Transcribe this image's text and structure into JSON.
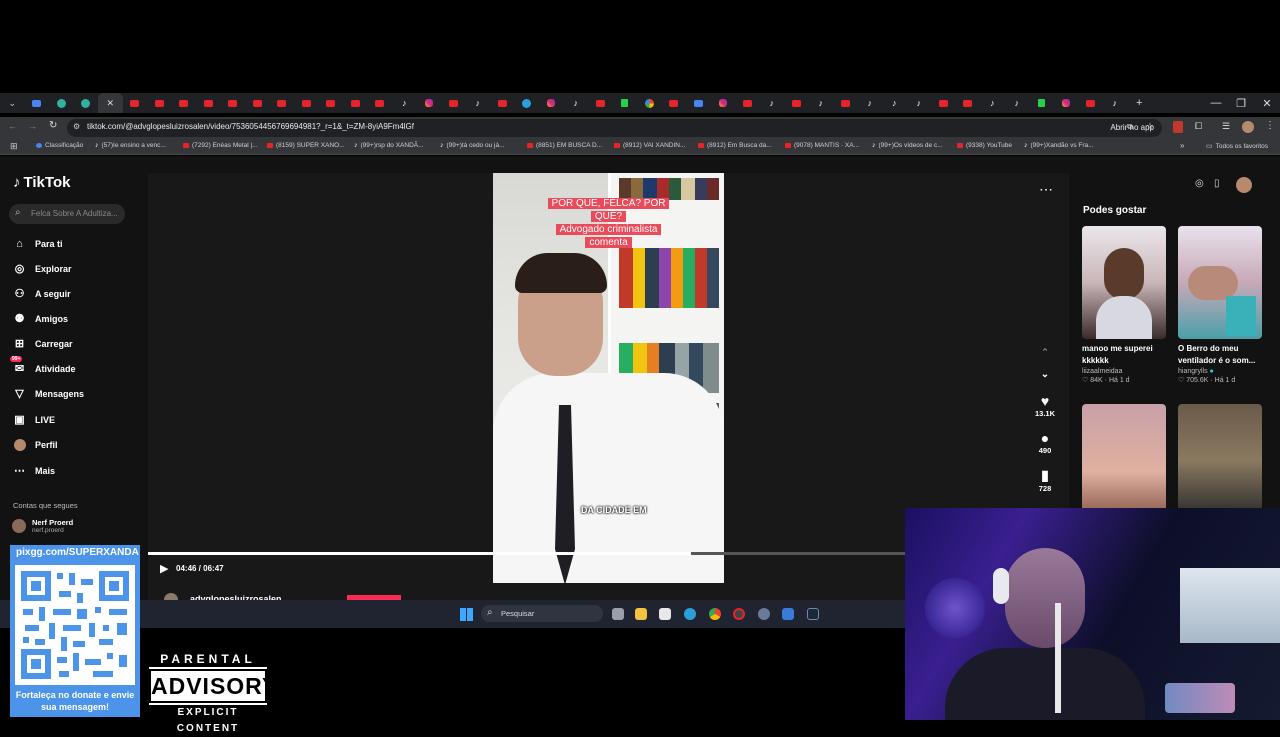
{
  "browser": {
    "url": "tiktok.com/@advglopesluizrosalen/video/7536054456769694981?_r=1&_t=ZM-8yiA9Fm4lGf",
    "open_app": "Abrir no app",
    "bookmarks": [
      "Classificação",
      "(57)Ie ensino a venc...",
      "(7292) Enéas Metal |...",
      "(8159) SUPER XANO...",
      "(99+)rsp do XANDÃ...",
      "(99+)tá cedo ou já...",
      "(8851) EM BUSCA D...",
      "(8912) VAI XANDIN...",
      "(8912) Em Busca da...",
      "(9078) MANTIS · XA...",
      "(99+)Os vídeos de c...",
      "(9338) YouTube",
      "(99+)Xandão vs Fra..."
    ],
    "all_bookmarks": "Todos os favoritos"
  },
  "sidebar": {
    "logo": "TikTok",
    "search_placeholder": "Felca Sobre A Adultiza...",
    "items": [
      {
        "label": "Para ti",
        "icon": "home-icon"
      },
      {
        "label": "Explorar",
        "icon": "compass-icon"
      },
      {
        "label": "A seguir",
        "icon": "person-follow-icon"
      },
      {
        "label": "Amigos",
        "icon": "friends-icon"
      },
      {
        "label": "Carregar",
        "icon": "upload-icon"
      },
      {
        "label": "Atividade",
        "icon": "activity-icon",
        "badge": "99+"
      },
      {
        "label": "Mensagens",
        "icon": "messages-icon"
      },
      {
        "label": "LIVE",
        "icon": "live-icon"
      },
      {
        "label": "Perfil",
        "icon": "profile-icon"
      },
      {
        "label": "Mais",
        "icon": "more-icon"
      }
    ],
    "following_title": "Contas que segues",
    "account": {
      "name": "Nerf Proerd",
      "handle": "nerf.proerd"
    }
  },
  "video": {
    "caption_lines": [
      "POR QUE, FELCA? POR",
      "QUÊ?",
      "Advogado criminalista",
      "comenta"
    ],
    "subtitle": "DA CIDADE EM",
    "time": "04:46 / 06:47",
    "progress_fraction": 0.715,
    "username": "advglopesluizrosalen",
    "likes": "13.1K",
    "comments": "490",
    "saves": "728"
  },
  "recommended": {
    "title": "Podes gostar",
    "items": [
      {
        "title": "manoo me superei kkkkkk",
        "user": "liizaalmeidaa",
        "views": "84K",
        "age": "Há 1 d"
      },
      {
        "title": "O Berro do meu ventilador é o som...",
        "user": "hiangrylls",
        "views": "705.6K",
        "age": "Há 1 d"
      }
    ]
  },
  "taskbar": {
    "search_label": "Pesquisar"
  },
  "overlay": {
    "qr_url": "pixgg.com/SUPERXANDA",
    "qr_message": "Fortaleça no donate e envie sua mensagem!",
    "advisory_top": "PARENTAL",
    "advisory_mid": "ADVISORY",
    "advisory_bottom": "EXPLICIT CONTENT"
  },
  "colors": {
    "accent": "#fe2c55",
    "caption_bg": "#ea4b5b",
    "qr_panel": "#4b94ea"
  }
}
